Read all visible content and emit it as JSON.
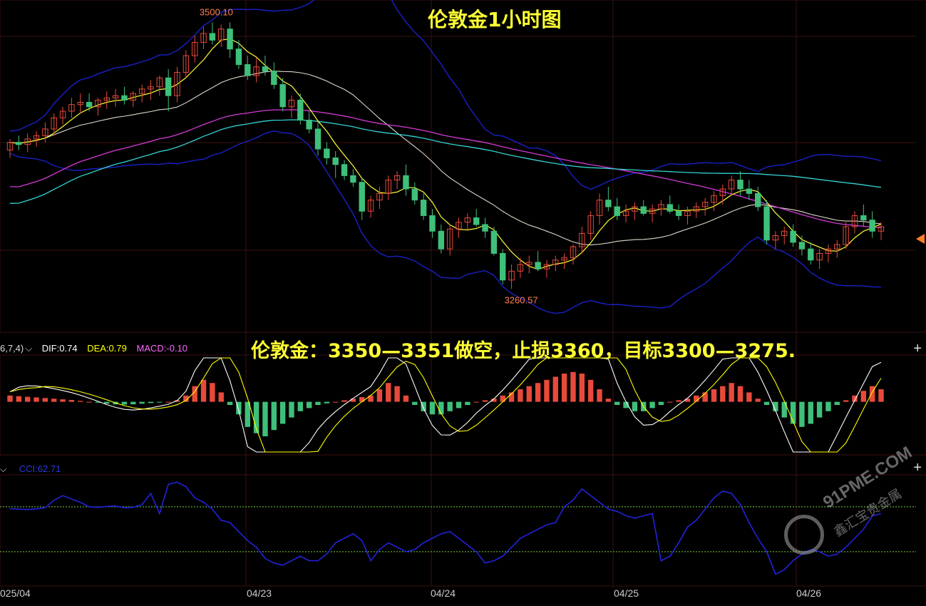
{
  "title": "伦敦金1小时图",
  "advice": "伦敦金：3350—3351做空，止损3360，目标3300—3275.",
  "macd_header": {
    "params": "6,7,4)",
    "dif_label": "DIF:0.74",
    "dea_label": "DEA:0.79",
    "macd_label": "MACD:-0.10",
    "colors": {
      "dif": "#ffffff",
      "dea": "#ffff00",
      "macd": "#ff66ff"
    }
  },
  "cci_header": {
    "label": "CCI:62.71",
    "color": "#2a3bdc"
  },
  "x_labels": [
    "025/04",
    "04/23",
    "04/24",
    "04/25",
    "04/26"
  ],
  "colors": {
    "up": "#e74a3b",
    "down": "#3ec07a",
    "ma_fast": "#ffff33",
    "ma_slow": "#ddd8c8",
    "boll": "#1a20c8",
    "ma_purple": "#d43ad8",
    "ma_cyan": "#33d2d2",
    "cci": "#2222dd",
    "grid": "#3a1010",
    "marker": "#ff7f27"
  },
  "icons": [
    "chevron-down-icon",
    "plus-icon",
    "price-marker-icon",
    "watermark-logo-icon"
  ],
  "watermark": {
    "main": "91PME.COM",
    "sub": "鑫汇宝贵金属"
  },
  "chart_data": {
    "type": "candlestick",
    "price_ylim": [
      3230,
      3515
    ],
    "high_label": "3500.10",
    "low_label": "3260.57",
    "candles": [
      [
        3385,
        3395,
        3378,
        3392
      ],
      [
        3392,
        3398,
        3385,
        3390
      ],
      [
        3390,
        3400,
        3383,
        3395
      ],
      [
        3395,
        3402,
        3388,
        3398
      ],
      [
        3398,
        3410,
        3392,
        3404
      ],
      [
        3404,
        3418,
        3398,
        3414
      ],
      [
        3414,
        3424,
        3408,
        3420
      ],
      [
        3420,
        3432,
        3414,
        3426
      ],
      [
        3426,
        3436,
        3418,
        3428
      ],
      [
        3428,
        3436,
        3420,
        3424
      ],
      [
        3424,
        3432,
        3416,
        3430
      ],
      [
        3430,
        3438,
        3422,
        3432
      ],
      [
        3432,
        3440,
        3424,
        3434
      ],
      [
        3434,
        3442,
        3426,
        3430
      ],
      [
        3430,
        3438,
        3424,
        3436
      ],
      [
        3436,
        3444,
        3428,
        3440
      ],
      [
        3440,
        3448,
        3430,
        3442
      ],
      [
        3442,
        3452,
        3434,
        3450
      ],
      [
        3450,
        3458,
        3420,
        3434
      ],
      [
        3434,
        3460,
        3428,
        3455
      ],
      [
        3455,
        3475,
        3450,
        3470
      ],
      [
        3470,
        3488,
        3464,
        3482
      ],
      [
        3482,
        3496,
        3476,
        3490
      ],
      [
        3490,
        3500,
        3480,
        3484
      ],
      [
        3484,
        3498,
        3478,
        3494
      ],
      [
        3494,
        3500,
        3468,
        3476
      ],
      [
        3476,
        3484,
        3458,
        3462
      ],
      [
        3462,
        3470,
        3448,
        3452
      ],
      [
        3452,
        3468,
        3446,
        3460
      ],
      [
        3460,
        3470,
        3452,
        3456
      ],
      [
        3456,
        3464,
        3440,
        3444
      ],
      [
        3444,
        3450,
        3420,
        3424
      ],
      [
        3424,
        3434,
        3414,
        3430
      ],
      [
        3430,
        3436,
        3408,
        3412
      ],
      [
        3412,
        3420,
        3400,
        3404
      ],
      [
        3404,
        3410,
        3380,
        3386
      ],
      [
        3386,
        3392,
        3372,
        3378
      ],
      [
        3378,
        3384,
        3360,
        3372
      ],
      [
        3372,
        3376,
        3358,
        3362
      ],
      [
        3362,
        3368,
        3352,
        3356
      ],
      [
        3356,
        3360,
        3322,
        3330
      ],
      [
        3330,
        3344,
        3324,
        3340
      ],
      [
        3340,
        3352,
        3332,
        3346
      ],
      [
        3346,
        3362,
        3340,
        3358
      ],
      [
        3358,
        3366,
        3350,
        3362
      ],
      [
        3362,
        3372,
        3344,
        3350
      ],
      [
        3350,
        3356,
        3336,
        3340
      ],
      [
        3340,
        3346,
        3322,
        3326
      ],
      [
        3326,
        3332,
        3306,
        3312
      ],
      [
        3312,
        3318,
        3292,
        3296
      ],
      [
        3296,
        3318,
        3290,
        3314
      ],
      [
        3314,
        3324,
        3306,
        3320
      ],
      [
        3320,
        3328,
        3312,
        3324
      ],
      [
        3324,
        3332,
        3316,
        3318
      ],
      [
        3318,
        3324,
        3306,
        3312
      ],
      [
        3312,
        3316,
        3290,
        3292
      ],
      [
        3292,
        3296,
        3264,
        3268
      ],
      [
        3268,
        3282,
        3260,
        3276
      ],
      [
        3276,
        3288,
        3270,
        3282
      ],
      [
        3282,
        3290,
        3274,
        3284
      ],
      [
        3284,
        3294,
        3276,
        3278
      ],
      [
        3278,
        3286,
        3270,
        3282
      ],
      [
        3282,
        3290,
        3276,
        3286
      ],
      [
        3286,
        3292,
        3278,
        3288
      ],
      [
        3288,
        3300,
        3282,
        3298
      ],
      [
        3298,
        3316,
        3292,
        3310
      ],
      [
        3310,
        3330,
        3304,
        3326
      ],
      [
        3326,
        3346,
        3318,
        3340
      ],
      [
        3340,
        3352,
        3330,
        3334
      ],
      [
        3334,
        3342,
        3322,
        3326
      ],
      [
        3326,
        3336,
        3320,
        3330
      ],
      [
        3330,
        3338,
        3322,
        3334
      ],
      [
        3334,
        3340,
        3326,
        3328
      ],
      [
        3328,
        3336,
        3320,
        3332
      ],
      [
        3332,
        3340,
        3326,
        3336
      ],
      [
        3336,
        3344,
        3328,
        3330
      ],
      [
        3330,
        3336,
        3322,
        3326
      ],
      [
        3326,
        3334,
        3318,
        3330
      ],
      [
        3330,
        3338,
        3324,
        3334
      ],
      [
        3334,
        3342,
        3326,
        3338
      ],
      [
        3338,
        3348,
        3330,
        3344
      ],
      [
        3344,
        3354,
        3336,
        3350
      ],
      [
        3350,
        3362,
        3344,
        3358
      ],
      [
        3358,
        3366,
        3344,
        3350
      ],
      [
        3350,
        3358,
        3340,
        3346
      ],
      [
        3346,
        3352,
        3330,
        3334
      ],
      [
        3334,
        3340,
        3300,
        3304
      ],
      [
        3304,
        3312,
        3296,
        3308
      ],
      [
        3308,
        3316,
        3300,
        3312
      ],
      [
        3312,
        3318,
        3298,
        3302
      ],
      [
        3302,
        3308,
        3290,
        3296
      ],
      [
        3296,
        3302,
        3282,
        3286
      ],
      [
        3286,
        3296,
        3278,
        3292
      ],
      [
        3292,
        3300,
        3284,
        3296
      ],
      [
        3296,
        3304,
        3288,
        3300
      ],
      [
        3300,
        3320,
        3296,
        3316
      ],
      [
        3316,
        3330,
        3310,
        3326
      ],
      [
        3326,
        3336,
        3316,
        3322
      ],
      [
        3322,
        3330,
        3306,
        3312
      ],
      [
        3312,
        3320,
        3304,
        3316
      ]
    ],
    "macd_ylim": [
      -16,
      14
    ],
    "macd_hist": [
      2,
      1.8,
      1.6,
      1.4,
      1.2,
      1,
      0.8,
      0.6,
      0.3,
      0,
      -0.3,
      -0.6,
      -0.8,
      -0.9,
      -0.8,
      -0.6,
      -0.4,
      -0.2,
      0,
      0.5,
      2,
      5,
      7,
      6,
      3,
      -1,
      -4,
      -8,
      -10,
      -11,
      -9,
      -7,
      -5,
      -3,
      -2,
      -1,
      -0.5,
      0,
      0.5,
      1,
      1.5,
      2,
      4,
      6,
      5,
      2,
      -1,
      -3,
      -4,
      -4,
      -3,
      -2,
      -1,
      0,
      0.5,
      1,
      2,
      3,
      4,
      5,
      6,
      7,
      8,
      9,
      9.5,
      9,
      7,
      4,
      1,
      -1,
      -2,
      -3,
      -3,
      -2,
      -1,
      0,
      0.5,
      1,
      2,
      3,
      4,
      5,
      6,
      5,
      3,
      1,
      -1,
      -3,
      -5,
      -7,
      -8,
      -7,
      -5,
      -3,
      -1,
      0.5,
      2,
      3.5,
      5,
      4
    ],
    "cci_ylim": [
      -240,
      230
    ],
    "cci_ref": [
      100,
      -100
    ],
    "cci": [
      92,
      90,
      88,
      91,
      96,
      130,
      150,
      135,
      120,
      100,
      98,
      102,
      104,
      96,
      98,
      110,
      160,
      70,
      200,
      210,
      190,
      140,
      120,
      90,
      40,
      30,
      -10,
      -50,
      -80,
      -130,
      -150,
      -160,
      -140,
      -120,
      -140,
      -140,
      -110,
      -60,
      -40,
      -20,
      -50,
      -140,
      -90,
      -60,
      -80,
      -100,
      -90,
      -60,
      -40,
      -20,
      -10,
      -40,
      -70,
      -100,
      -150,
      -140,
      -120,
      -80,
      -40,
      -20,
      0,
      20,
      30,
      100,
      130,
      180,
      150,
      120,
      90,
      80,
      60,
      50,
      60,
      70,
      -140,
      -120,
      -60,
      10,
      40,
      90,
      140,
      170,
      160,
      110,
      30,
      -40,
      -100,
      -200,
      -180,
      -140,
      -110,
      -90,
      -100,
      -120,
      -110,
      -80,
      -40,
      0,
      60,
      70
    ]
  }
}
